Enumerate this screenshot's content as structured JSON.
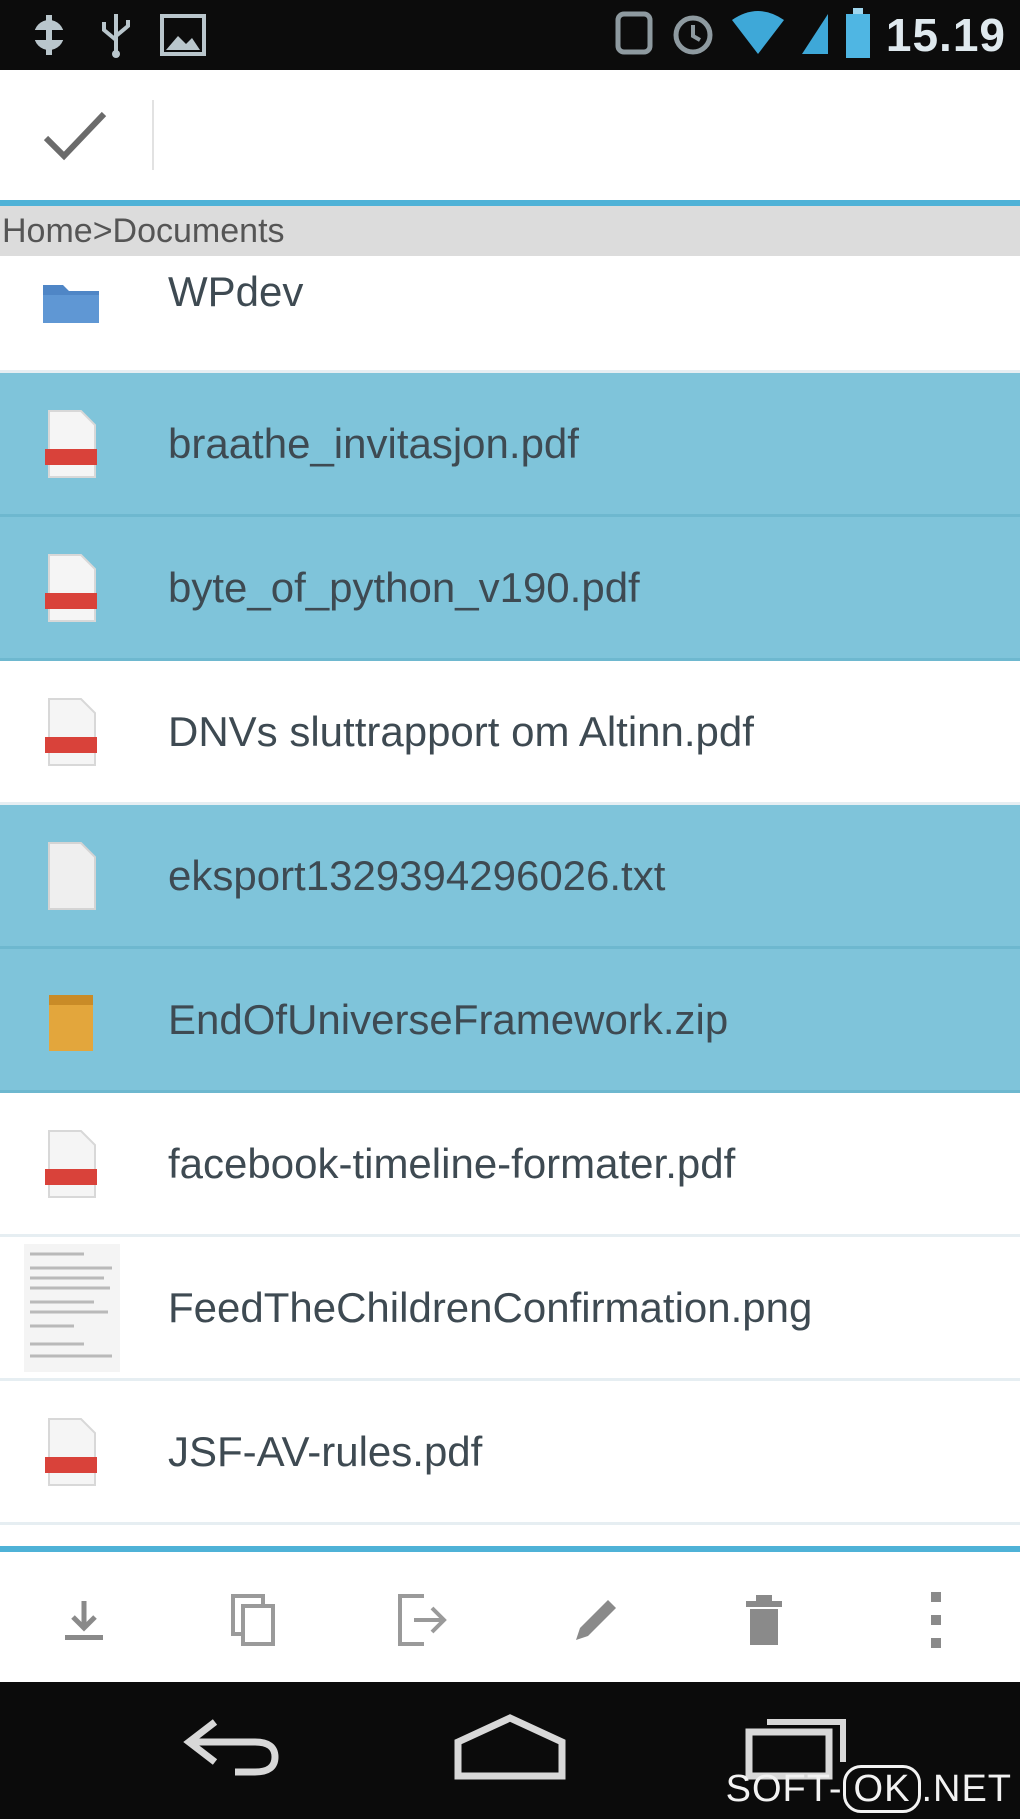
{
  "status_bar": {
    "time": "15.19",
    "icons": [
      "android-debug-icon",
      "usb-icon",
      "image-notification-icon",
      "sync-icon",
      "alarm-icon",
      "wifi-icon",
      "signal-icon",
      "battery-icon"
    ]
  },
  "action_bar": {
    "done_icon": "checkmark-icon"
  },
  "breadcrumb": "Home>Documents",
  "files": [
    {
      "name": "WPdev",
      "type": "folder",
      "selected": false
    },
    {
      "name": "braathe_invitasjon.pdf",
      "type": "pdf",
      "selected": true
    },
    {
      "name": "byte_of_python_v190.pdf",
      "type": "pdf",
      "selected": true
    },
    {
      "name": "DNVs sluttrapport om Altinn.pdf",
      "type": "pdf",
      "selected": false
    },
    {
      "name": "eksport1329394296026.txt",
      "type": "txt",
      "selected": true
    },
    {
      "name": "EndOfUniverseFramework.zip",
      "type": "zip",
      "selected": true
    },
    {
      "name": "facebook-timeline-formater.pdf",
      "type": "pdf",
      "selected": false
    },
    {
      "name": "FeedTheChildrenConfirmation.png",
      "type": "png",
      "selected": false
    },
    {
      "name": "JSF-AV-rules.pdf",
      "type": "pdf",
      "selected": false
    }
  ],
  "bottom_actions": [
    "download-icon",
    "copy-icon",
    "move-icon",
    "rename-pencil-icon",
    "delete-trash-icon",
    "overflow-menu-icon"
  ],
  "nav_bar": [
    "back-icon",
    "home-icon",
    "recent-apps-icon"
  ],
  "watermark": {
    "prefix": "SOFT-",
    "boxed": "OK",
    "suffix": ".NET"
  },
  "colors": {
    "accent": "#4fb2d7",
    "selected_row": "#7fc4da",
    "pdf_red": "#d9423a",
    "folder_blue": "#4f86c6",
    "zip_orange": "#e3a63c"
  }
}
